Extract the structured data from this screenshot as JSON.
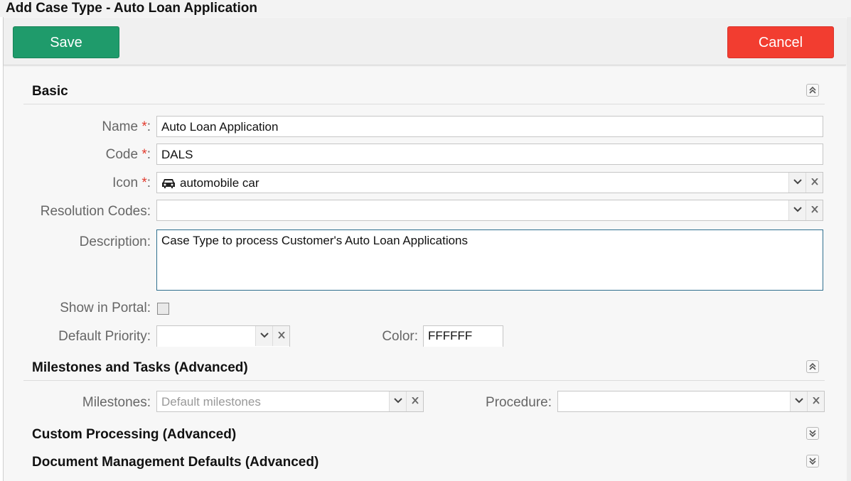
{
  "window": {
    "title": "Add Case Type - Auto Loan Application"
  },
  "toolbar": {
    "save_label": "Save",
    "cancel_label": "Cancel"
  },
  "colors": {
    "save": "#1f9b6b",
    "cancel": "#f23d30",
    "required": "#e23b2e"
  },
  "sections": {
    "basic": {
      "title": "Basic",
      "state_icon": "chevron-double-up-icon"
    },
    "milestones": {
      "title": "Milestones and Tasks (Advanced)",
      "state_icon": "chevron-double-up-icon"
    },
    "custom": {
      "title": "Custom Processing (Advanced)",
      "state_icon": "chevron-double-down-icon"
    },
    "document": {
      "title": "Document Management Defaults (Advanced)",
      "state_icon": "chevron-double-down-icon"
    }
  },
  "basic": {
    "name_label": "Name",
    "name_value": "Auto Loan Application",
    "code_label": "Code",
    "code_value": "DALS",
    "icon_label": "Icon",
    "icon_value": "automobile car",
    "icon_glyph": "car-icon",
    "resolution_label": "Resolution Codes:",
    "resolution_value": "",
    "description_label": "Description:",
    "description_value": "Case Type to process Customer's Auto Loan Applications",
    "portal_label": "Show in Portal:",
    "portal_checked": false,
    "priority_label": "Default Priority:",
    "priority_value": "",
    "color_label": "Color:",
    "color_value": "FFFFFF",
    "required_mark": "*",
    "colon": ":"
  },
  "milestones": {
    "milestones_label": "Milestones:",
    "milestones_placeholder": "Default milestones",
    "procedure_label": "Procedure:",
    "procedure_value": ""
  }
}
